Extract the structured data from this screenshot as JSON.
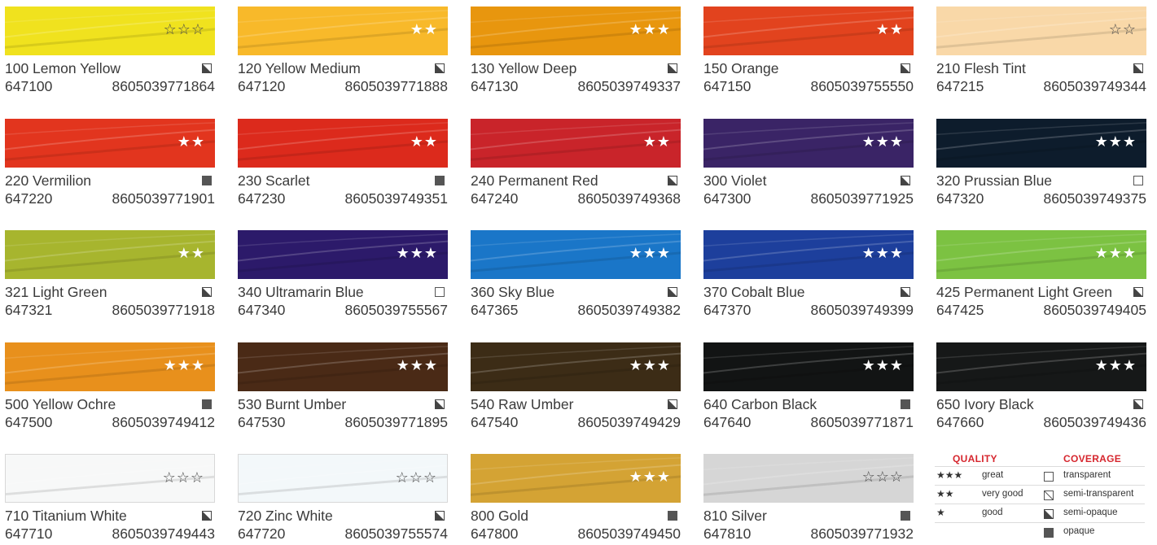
{
  "swatches": [
    {
      "name": "100 Lemon Yellow",
      "code": "647100",
      "ean": "8605039771864",
      "quality": 3,
      "quality_style": "outline",
      "coverage": "semi-opaque",
      "color": "#f0e21e",
      "light": false
    },
    {
      "name": "120 Yellow Medium",
      "code": "647120",
      "ean": "8605039771888",
      "quality": 2,
      "quality_style": "filled",
      "coverage": "semi-opaque",
      "color": "#f8b92a",
      "light": false
    },
    {
      "name": "130 Yellow Deep",
      "code": "647130",
      "ean": "8605039749337",
      "quality": 3,
      "quality_style": "filled",
      "coverage": "semi-opaque",
      "color": "#e8960e",
      "light": false
    },
    {
      "name": "150 Orange",
      "code": "647150",
      "ean": "8605039755550",
      "quality": 2,
      "quality_style": "filled",
      "coverage": "semi-opaque",
      "color": "#e2431e",
      "light": false
    },
    {
      "name": "210 Flesh Tint",
      "code": "647215",
      "ean": "8605039749344",
      "quality": 2,
      "quality_style": "outline",
      "coverage": "semi-opaque",
      "color": "#f9d8a8",
      "light": false
    },
    {
      "name": "220 Vermilion",
      "code": "647220",
      "ean": "8605039771901",
      "quality": 2,
      "quality_style": "filled",
      "coverage": "opaque",
      "color": "#e2351e",
      "light": false
    },
    {
      "name": "230 Scarlet",
      "code": "647230",
      "ean": "8605039749351",
      "quality": 2,
      "quality_style": "filled",
      "coverage": "opaque",
      "color": "#dc2a1c",
      "light": false
    },
    {
      "name": "240 Permanent Red",
      "code": "647240",
      "ean": "8605039749368",
      "quality": 2,
      "quality_style": "filled",
      "coverage": "semi-opaque",
      "color": "#c9242a",
      "light": false
    },
    {
      "name": "300 Violet",
      "code": "647300",
      "ean": "8605039771925",
      "quality": 3,
      "quality_style": "filled",
      "coverage": "semi-opaque",
      "color": "#3a2466",
      "light": false
    },
    {
      "name": "320 Prussian Blue",
      "code": "647320",
      "ean": "8605039749375",
      "quality": 3,
      "quality_style": "filled",
      "coverage": "transparent",
      "color": "#0d1c2c",
      "light": false
    },
    {
      "name": "321 Light Green",
      "code": "647321",
      "ean": "8605039771918",
      "quality": 2,
      "quality_style": "filled",
      "coverage": "semi-opaque",
      "color": "#a7b52e",
      "light": false
    },
    {
      "name": "340 Ultramarin Blue",
      "code": "647340",
      "ean": "8605039755567",
      "quality": 3,
      "quality_style": "filled",
      "coverage": "transparent",
      "color": "#2c1a6a",
      "light": false
    },
    {
      "name": "360 Sky Blue",
      "code": "647365",
      "ean": "8605039749382",
      "quality": 3,
      "quality_style": "filled",
      "coverage": "semi-opaque",
      "color": "#1a76c8",
      "light": false
    },
    {
      "name": "370 Cobalt Blue",
      "code": "647370",
      "ean": "8605039749399",
      "quality": 3,
      "quality_style": "filled",
      "coverage": "semi-opaque",
      "color": "#1d3f9c",
      "light": false
    },
    {
      "name": "425 Permanent Light Green",
      "code": "647425",
      "ean": "8605039749405",
      "quality": 3,
      "quality_style": "filled",
      "coverage": "semi-opaque",
      "color": "#7cc242",
      "light": false
    },
    {
      "name": "500 Yellow Ochre",
      "code": "647500",
      "ean": "8605039749412",
      "quality": 3,
      "quality_style": "filled",
      "coverage": "opaque",
      "color": "#e8901c",
      "light": false
    },
    {
      "name": "530 Burnt Umber",
      "code": "647530",
      "ean": "8605039771895",
      "quality": 3,
      "quality_style": "filled",
      "coverage": "semi-opaque",
      "color": "#4a2a16",
      "light": false
    },
    {
      "name": "540 Raw Umber",
      "code": "647540",
      "ean": "8605039749429",
      "quality": 3,
      "quality_style": "filled",
      "coverage": "semi-opaque",
      "color": "#3c2c16",
      "light": false
    },
    {
      "name": "640 Carbon Black",
      "code": "647640",
      "ean": "8605039771871",
      "quality": 3,
      "quality_style": "filled",
      "coverage": "opaque",
      "color": "#121414",
      "light": false
    },
    {
      "name": "650 Ivory Black",
      "code": "647660",
      "ean": "8605039749436",
      "quality": 3,
      "quality_style": "filled",
      "coverage": "semi-opaque",
      "color": "#161818",
      "light": false
    },
    {
      "name": "710 Titanium White",
      "code": "647710",
      "ean": "8605039749443",
      "quality": 3,
      "quality_style": "outline",
      "coverage": "semi-opaque",
      "color": "#f7f8f8",
      "light": true
    },
    {
      "name": "720 Zinc White",
      "code": "647720",
      "ean": "8605039755574",
      "quality": 3,
      "quality_style": "outline",
      "coverage": "semi-opaque",
      "color": "#f3f8fa",
      "light": true
    },
    {
      "name": "800 Gold",
      "code": "647800",
      "ean": "8605039749450",
      "quality": 3,
      "quality_style": "filled",
      "coverage": "opaque",
      "color": "#d4a334",
      "light": false
    },
    {
      "name": "810 Silver",
      "code": "647810",
      "ean": "8605039771932",
      "quality": 3,
      "quality_style": "outline",
      "coverage": "opaque",
      "color": "#d6d6d6",
      "light": false
    }
  ],
  "legend": {
    "quality_title": "QUALITY",
    "coverage_title": "COVERAGE",
    "rows": [
      {
        "stars": "★★★",
        "quality": "great",
        "coverage_icon": "transparent",
        "coverage": "transparent"
      },
      {
        "stars": "★★",
        "quality": "very good",
        "coverage_icon": "semi-transparent",
        "coverage": "semi-transparent"
      },
      {
        "stars": "★",
        "quality": "good",
        "coverage_icon": "semi-opaque",
        "coverage": "semi-opaque"
      },
      {
        "stars": "",
        "quality": "",
        "coverage_icon": "opaque",
        "coverage": "opaque"
      }
    ]
  },
  "colors": {
    "legend_red": "#d6262e",
    "text": "#3a3a3a"
  }
}
